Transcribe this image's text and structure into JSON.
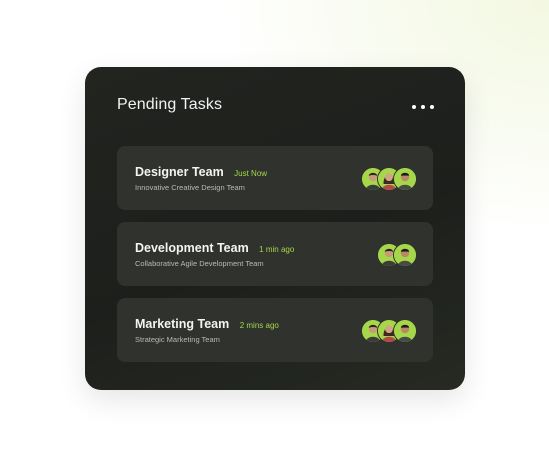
{
  "card": {
    "title": "Pending Tasks"
  },
  "tasks": [
    {
      "name": "Designer Team",
      "time": "Just Now",
      "description": "Innovative Creative Design Team",
      "avatar_icons": [
        "member-man-icon",
        "member-woman-icon",
        "member-man-icon"
      ]
    },
    {
      "name": "Development Team",
      "time": "1 min ago",
      "description": "Collaborative Agile Development Team",
      "avatar_icons": [
        "member-man-icon",
        "member-man-icon"
      ]
    },
    {
      "name": "Marketing Team",
      "time": "2 mins ago",
      "description": "Strategic Marketing Team",
      "avatar_icons": [
        "member-man-icon",
        "member-woman-icon",
        "member-man-icon"
      ]
    }
  ],
  "colors": {
    "card_background": "#1f211e",
    "task_background": "#2f322d",
    "accent": "#a6d64a",
    "title_text": "#f2f2f2",
    "subtle_text": "#b9bab6"
  }
}
